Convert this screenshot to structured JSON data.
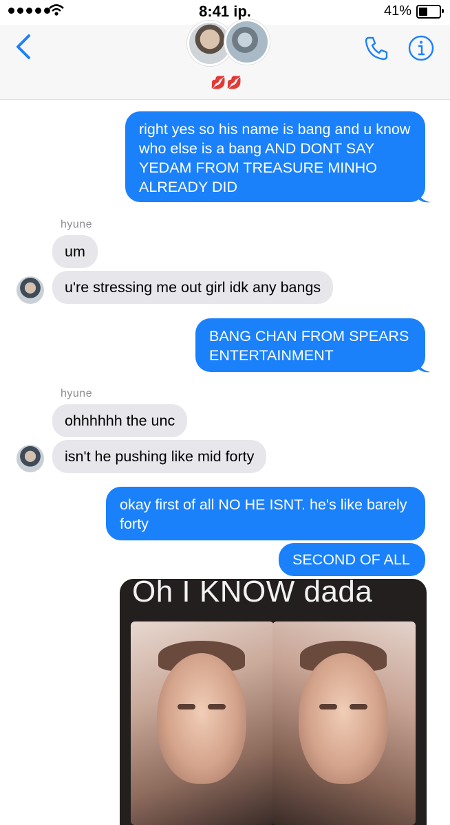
{
  "status_bar": {
    "time": "8:41 ip.",
    "battery": "41%",
    "battery_level": 0.41
  },
  "header": {
    "title_emoji": "💋💋",
    "icons": [
      "back-chevron",
      "phone-icon",
      "info-icon"
    ]
  },
  "colors": {
    "outgoing_bubble": "#1a81fb",
    "incoming_bubble": "#e6e6eb",
    "accent": "#1a81fb"
  },
  "messages": [
    {
      "from": "me",
      "text": "right yes so his name is bang and u know who else is a bang AND DONT SAY YEDAM FROM TREASURE MINHO ALREADY DID"
    },
    {
      "from": "hyune",
      "sender_label": "hyune",
      "text": "um"
    },
    {
      "from": "hyune",
      "text": "u're stressing me out girl idk any bangs"
    },
    {
      "from": "me",
      "text": "BANG CHAN FROM SPEARS ENTERTAINMENT"
    },
    {
      "from": "hyune",
      "sender_label": "hyune",
      "text": "ohhhhhh the unc"
    },
    {
      "from": "hyune",
      "text": "isn't he pushing like mid forty"
    },
    {
      "from": "me",
      "text": "okay first of all NO HE ISNT. he's like barely forty"
    },
    {
      "from": "me",
      "text": "SECOND OF ALL"
    },
    {
      "from": "me",
      "type": "image",
      "caption": "Oh I KNOW dada"
    }
  ]
}
